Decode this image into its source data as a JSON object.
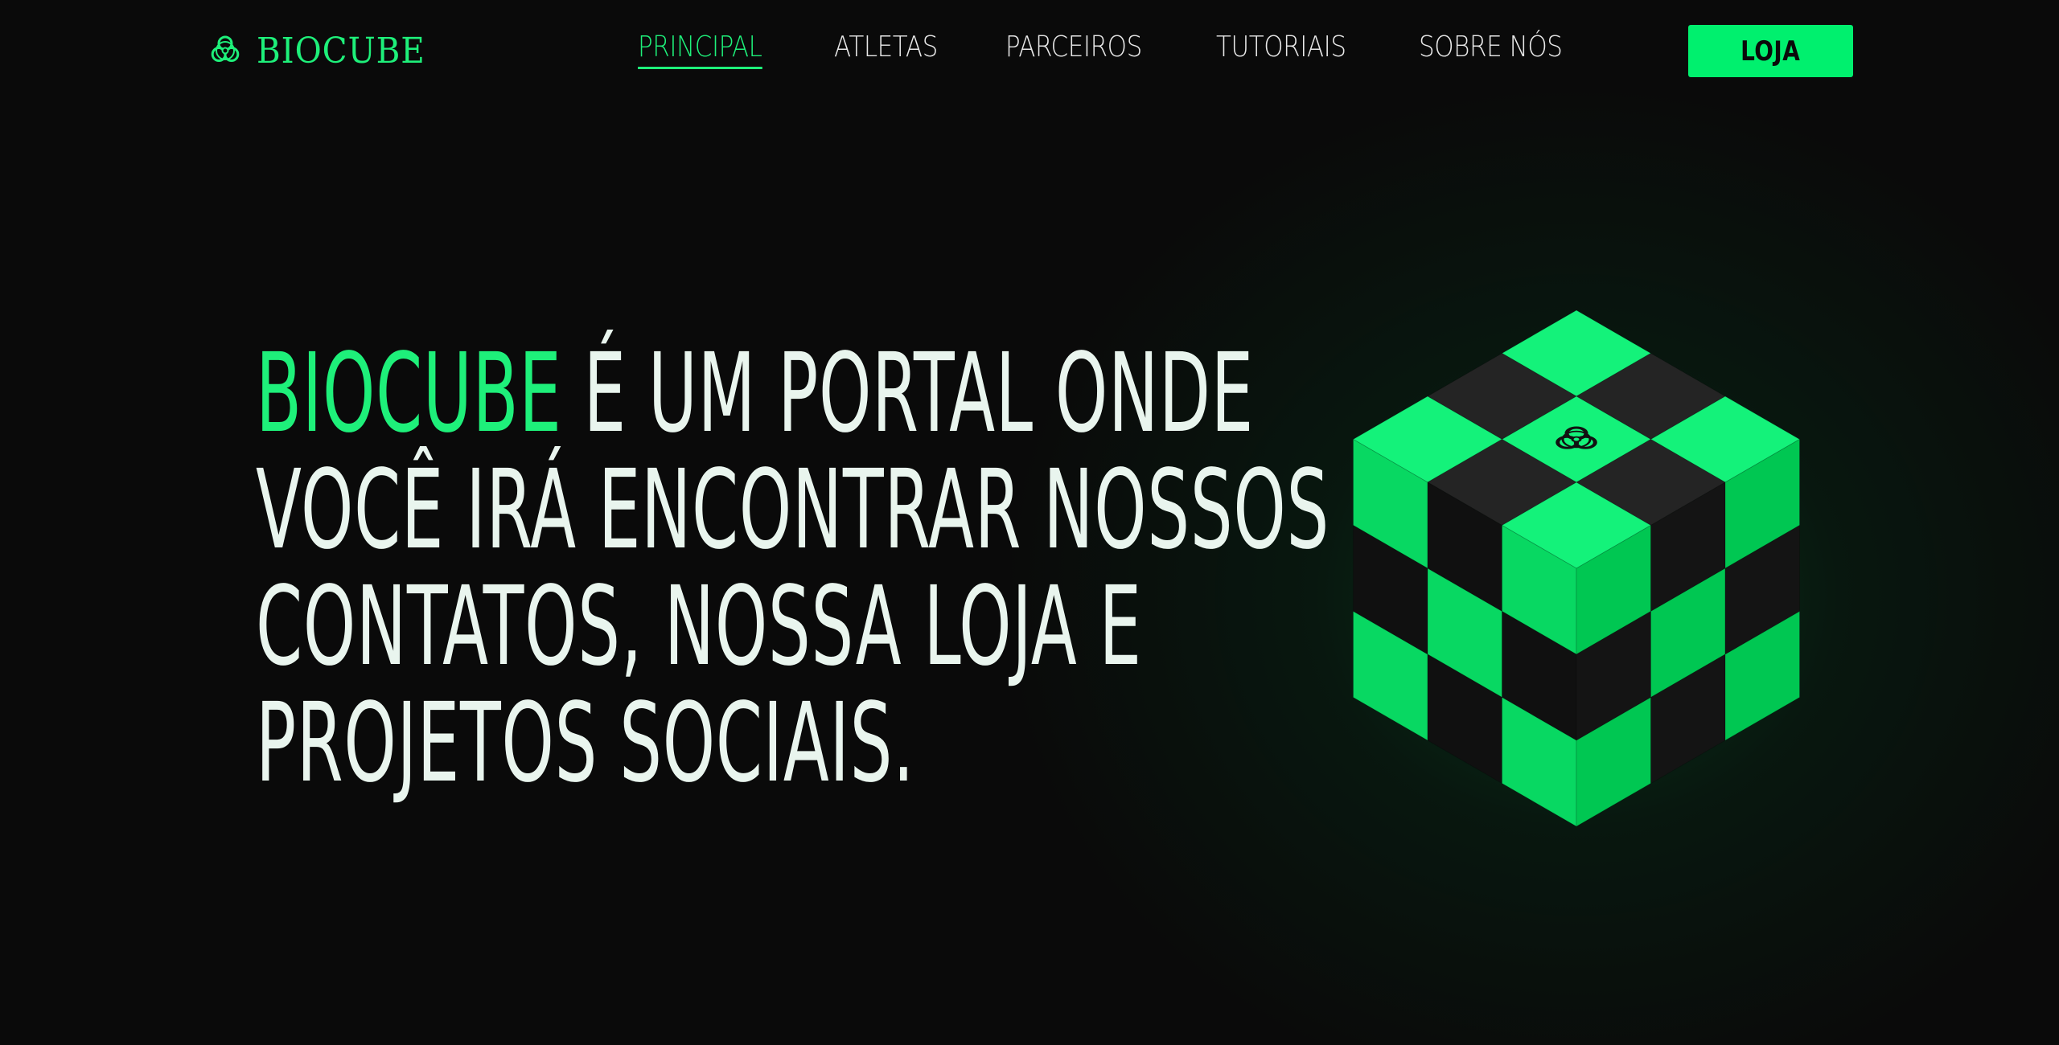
{
  "brand": {
    "name": "BIOCUBE",
    "icon": "biohazard-icon",
    "color": "#1ef07a"
  },
  "nav": {
    "items": [
      {
        "label": "PRINCIPAL",
        "active": true
      },
      {
        "label": "ATLETAS",
        "active": false
      },
      {
        "label": "PARCEIROS",
        "active": false
      },
      {
        "label": "TUTORIAIS",
        "active": false
      },
      {
        "label": "SOBRE NÓS",
        "active": false
      }
    ],
    "shop_label": "LOJA"
  },
  "hero": {
    "accent_word": "BIOCUBE",
    "line1_rest": " É UM PORTAL ONDE",
    "line2": "VOCÊ IRÁ ENCONTRAR NOSSOS",
    "line3": "CONTATOS, NOSSA LOJA E",
    "line4": "PROJETOS SOCIAIS."
  },
  "cube": {
    "center_icon": "biohazard-icon",
    "colors": {
      "green_top": "#14f27a",
      "green_left": "#08d862",
      "green_right": "#00c752",
      "dark_top": "#242424",
      "dark_left": "#101010",
      "dark_right": "#141414"
    }
  },
  "colors": {
    "background": "#0a0a0a",
    "accent": "#1ef07a",
    "button": "#00f06e",
    "text": "#e9f5ee"
  }
}
